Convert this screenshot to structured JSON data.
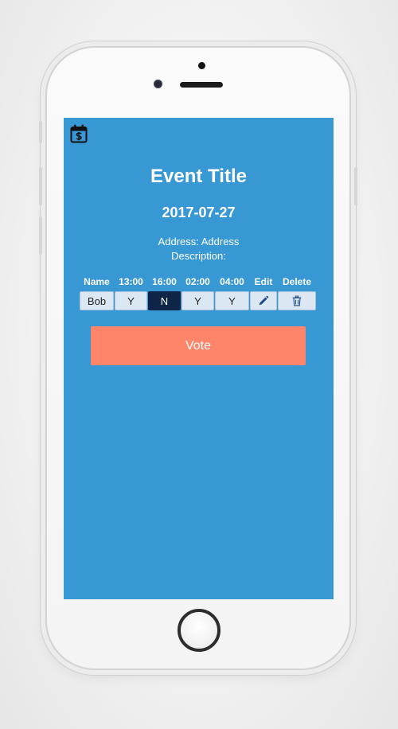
{
  "event": {
    "title": "Event Title",
    "date": "2017-07-27",
    "address": "Address: Address",
    "description": "Description:"
  },
  "table": {
    "headers": [
      "Name",
      "13:00",
      "16:00",
      "02:00",
      "04:00",
      "Edit",
      "Delete"
    ],
    "rows": [
      {
        "name": "Bob",
        "votes": [
          "Y",
          "N",
          "Y",
          "Y"
        ],
        "edit_icon": "pencil-icon",
        "delete_icon": "trash-icon"
      }
    ]
  },
  "vote_button": {
    "label": "Vote"
  },
  "icons": {
    "app": "calendar-dollar-icon"
  },
  "colors": {
    "screen_bg": "#3898d4",
    "vote_bg": "#fe846a",
    "cell_bg": "#dbe7f3",
    "selected_no": "#0e2547"
  }
}
